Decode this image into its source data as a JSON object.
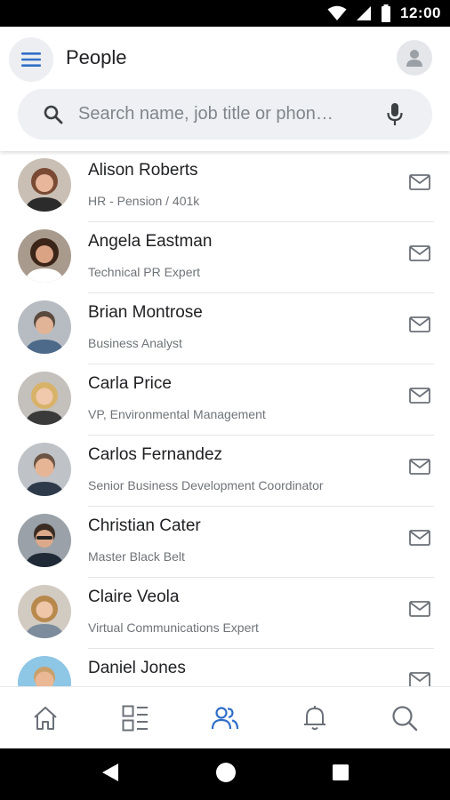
{
  "status_bar": {
    "time": "12:00",
    "icons": [
      "wifi-icon",
      "cell-signal-icon",
      "battery-icon"
    ]
  },
  "header": {
    "title": "People",
    "menu_icon": "hamburger-menu-icon",
    "profile_icon": "person-icon"
  },
  "search": {
    "placeholder": "Search name, job title or phon…",
    "value": "",
    "icons": [
      "search-icon",
      "mic-icon"
    ]
  },
  "people": [
    {
      "name": "Alison Roberts",
      "title": "HR - Pension / 401k"
    },
    {
      "name": "Angela Eastman",
      "title": "Technical PR Expert"
    },
    {
      "name": "Brian Montrose",
      "title": "Business Analyst"
    },
    {
      "name": "Carla Price",
      "title": "VP, Environmental Management"
    },
    {
      "name": "Carlos Fernandez",
      "title": "Senior Business Development Coordinator"
    },
    {
      "name": "Christian Cater",
      "title": "Master Black Belt"
    },
    {
      "name": "Claire Veola",
      "title": "Virtual Communications Expert"
    },
    {
      "name": "Daniel Jones",
      "title": ""
    }
  ],
  "bottom_nav": {
    "items": [
      "home-icon",
      "dashboard-icon",
      "people-icon",
      "notifications-icon",
      "search-icon"
    ],
    "active": "people-icon"
  },
  "colors": {
    "accent": "#2f6ec8",
    "icon_gray": "#6b7078",
    "search_bg": "#eef0f3"
  }
}
